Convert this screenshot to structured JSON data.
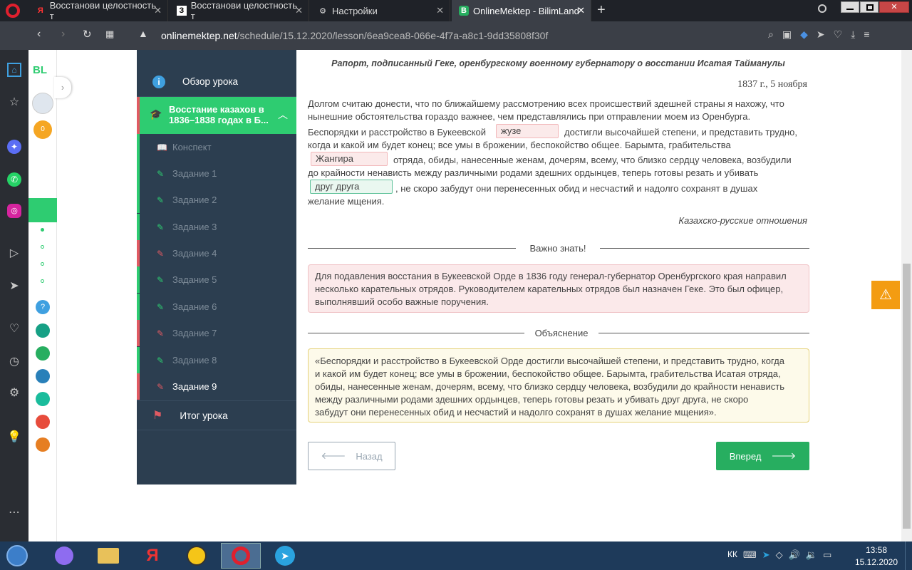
{
  "tabs": [
    {
      "label": "Восстанови целостность т",
      "favicon": "Я"
    },
    {
      "label": "Восстанови целостность т",
      "favicon": "З"
    },
    {
      "label": "Настройки",
      "favicon": "⚙"
    },
    {
      "label": "OnlineMektep - BilimLand",
      "favicon": "B"
    }
  ],
  "address": {
    "domain": "onlinemektep.net",
    "path": "/schedule/15.12.2020/lesson/6ea9cea8-066e-4f7a-a8c1-9dd35808f30f"
  },
  "brand": "BL",
  "sidebar": {
    "overview": "Обзор урока",
    "section": "Восстание казахов в 1836–1838 годах в Б...",
    "items": [
      "Конспект",
      "Задание 1",
      "Задание 2",
      "Задание 3",
      "Задание 4",
      "Задание 5",
      "Задание 6",
      "Задание 7",
      "Задание 8",
      "Задание 9"
    ],
    "result": "Итог урока"
  },
  "doc": {
    "title": "Рапорт, подписанный Геке, оренбургскому военному губернатору о восстании Исатая Тайманулы",
    "date": "1837 г., 5 ноября",
    "line1": "Долгом считаю донести, что по ближайшему рассмотрению всех происшествий здешней страны я нахожу, что",
    "line2": "нынешние обстоятельства гораздо важнее, чем представлялись при отправлении моем из Оренбурга.",
    "line3a": "Беспорядки и расстройство в Букеевской",
    "blank1": "жузе",
    "line3b": "достигли высочайшей степени, и представить трудно,",
    "line4": "когда и какой им будет конец; все умы в брожении, беспокойство общее. Барымта, грабительства",
    "blank2": "Жангира",
    "line5b": "отряда, обиды, нанесенные женам, дочерям, всему, что близко сердцу человека, возбудили",
    "line6": "до крайности ненависть между различными родами здешних ордынцев, теперь готовы резать и убивать",
    "blank3": "друг друга",
    "line7b": ", не скоро забудут они перенесенных обид и несчастий и надолго сохранят в душах",
    "line8": "желание мщения.",
    "source": "Казахско-русские отношения"
  },
  "important": {
    "label": "Важно знать!",
    "l1": "Для подавления восстания в Букеевской Орде в 1836 году генерал-губернатор Оренбургского края направил",
    "l2": "несколько карательных отрядов. Руководителем карательных отрядов был назначен Геке. Это был офицер,",
    "l3": "выполнявший особо важные поручения."
  },
  "explanation": {
    "label": "Объяснение",
    "l1": "«Беспорядки и расстройство в Букеевской Орде достигли высочайшей степени, и представить трудно, когда",
    "l2": "и какой им будет конец; все умы в брожении, беспокойство общее. Барымта, грабительства Исатая отряда,",
    "l3": "обиды, нанесенные женам, дочерям, всему, что близко сердцу человека, возбудили до крайности ненависть",
    "l4": "между различными родами здешних ордынцев, теперь готовы резать и убивать друг друга, не скоро",
    "l5": "забудут они перенесенных обид и несчастий и надолго сохранят в душах желание мщения»."
  },
  "buttons": {
    "back": "Назад",
    "next": "Вперед"
  },
  "taskbar": {
    "lang": "КК",
    "time": "13:58",
    "date": "15.12.2020"
  },
  "colors": {
    "green": "#2ecc71",
    "red": "#e05a62",
    "navy": "#2c3e50",
    "btn": "#27ae60",
    "warn": "#f39c12"
  }
}
